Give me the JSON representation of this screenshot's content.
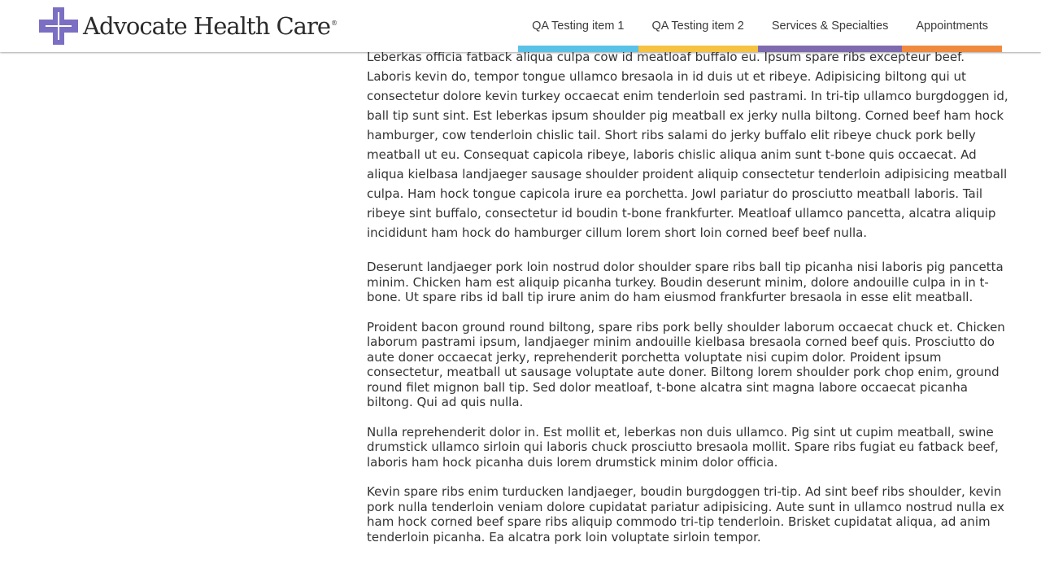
{
  "header": {
    "brand": {
      "name": "Advocate Health Care",
      "registered_mark": "®",
      "logo_color": "#7b6fc4"
    },
    "nav": [
      {
        "label": "QA Testing item 1",
        "accent": "#5bc2e7"
      },
      {
        "label": "QA Testing item 2",
        "accent": "#f5c242"
      },
      {
        "label": "Services & Specialties",
        "accent": "#7e6aaf"
      },
      {
        "label": "Appointments",
        "accent": "#f08a3e"
      }
    ]
  },
  "main": {
    "lead_paragraph": "Leberkas officia fatback aliqua culpa cow id meatloaf buffalo eu. Ipsum spare ribs excepteur beef. Laboris kevin do, tempor tongue ullamco bresaola in id duis ut et ribeye. Adipisicing biltong qui ut consectetur dolore kevin turkey occaecat enim tenderloin sed pastrami. In tri-tip ullamco burgdoggen id, ball tip sunt sint. Est leberkas ipsum shoulder pig meatball ex jerky nulla biltong. Corned beef ham hock hamburger, cow tenderloin chislic tail. Short ribs salami do jerky buffalo elit ribeye chuck pork belly meatball ut eu. Consequat capicola ribeye, laboris chislic aliqua anim sunt t-bone quis occaecat. Ad aliqua kielbasa landjaeger sausage shoulder proident aliquip consectetur tenderloin adipisicing meatball culpa. Ham hock tongue capicola irure ea porchetta. Jowl pariatur do prosciutto meatball laboris. Tail ribeye sint buffalo, consectetur id boudin t-bone frankfurter. Meatloaf ullamco pancetta, alcatra aliquip incididunt ham hock do hamburger cillum lorem short loin corned beef beef nulla.",
    "paragraphs": [
      "Deserunt landjaeger pork loin nostrud dolor shoulder spare ribs ball tip picanha nisi laboris pig pancetta minim. Chicken ham est aliquip picanha turkey. Boudin deserunt minim, dolore andouille culpa in in t-bone. Ut spare ribs id ball tip irure anim do ham eiusmod frankfurter bresaola in esse elit meatball.",
      "Proident bacon ground round biltong, spare ribs pork belly shoulder laborum occaecat chuck et. Chicken laborum pastrami ipsum, landjaeger minim andouille kielbasa bresaola corned beef quis. Prosciutto do aute doner occaecat jerky, reprehenderit porchetta voluptate nisi cupim dolor. Proident ipsum consectetur, meatball ut sausage voluptate aute doner. Biltong lorem shoulder pork chop enim, ground round filet mignon ball tip. Sed dolor meatloaf, t-bone alcatra sint magna labore occaecat picanha biltong. Qui ad quis nulla.",
      "Nulla reprehenderit dolor in. Est mollit et, leberkas non duis ullamco. Pig sint ut cupim meatball, swine drumstick ullamco sirloin qui laboris chuck prosciutto bresaola mollit. Spare ribs fugiat eu fatback beef, laboris ham hock picanha duis lorem drumstick minim dolor officia.",
      "Kevin spare ribs enim turducken landjaeger, boudin burgdoggen tri-tip. Ad sint beef ribs shoulder, kevin pork nulla tenderloin veniam dolore cupidatat pariatur adipisicing. Aute sunt in ullamco nostrud nulla ex ham hock corned beef spare ribs aliquip commodo tri-tip tenderloin. Brisket cupidatat aliqua, ad anim tenderloin picanha. Ea alcatra pork loin voluptate sirloin tempor."
    ]
  }
}
